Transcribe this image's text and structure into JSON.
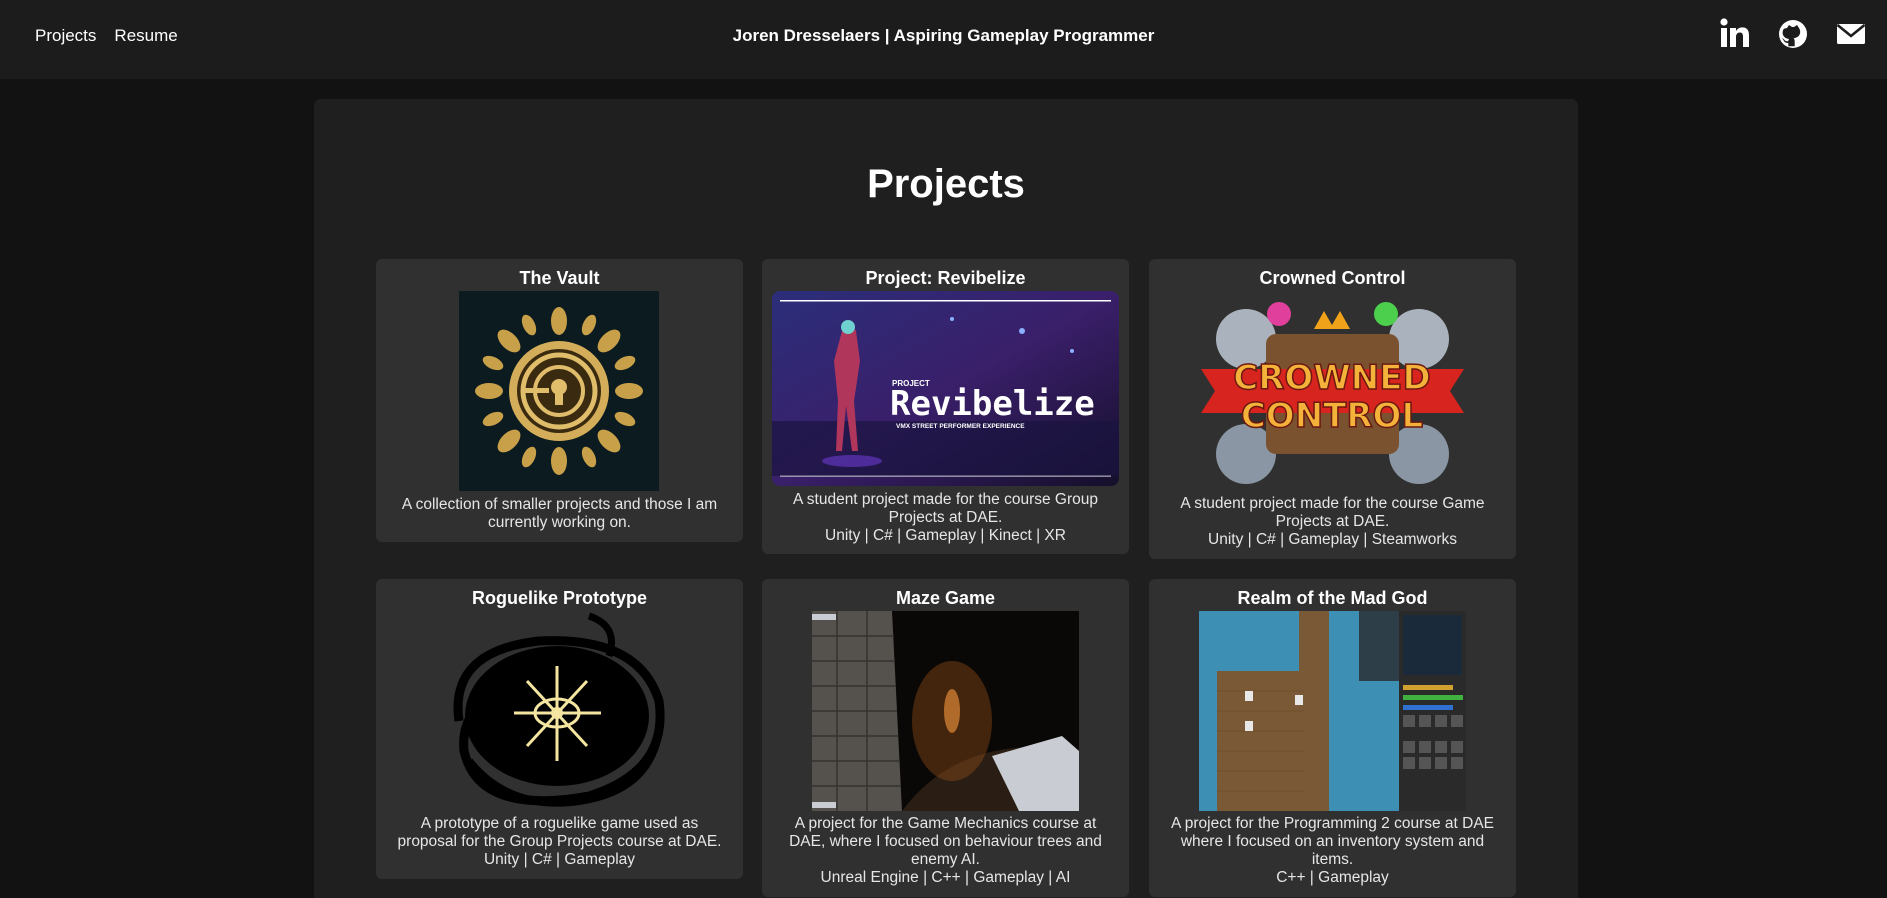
{
  "nav": {
    "links": [
      {
        "label": "Projects"
      },
      {
        "label": "Resume"
      }
    ],
    "title": "Joren Dresselaers | Aspiring Gameplay Programmer",
    "social_icons": [
      "linkedin-icon",
      "github-icon",
      "mail-icon"
    ]
  },
  "main": {
    "heading": "Projects",
    "cards": [
      {
        "title": "The Vault",
        "description": "A collection of smaller projects and those I am currently working on.",
        "tags": ""
      },
      {
        "title": "Project: Revibelize",
        "image_caption": "Revibelize",
        "image_subcaption": "PROJECT",
        "image_tagline": "VMX STREET PERFORMER EXPERIENCE",
        "description": "A student project made for the course Group Projects at DAE.",
        "tags": "Unity | C# | Gameplay | Kinect | XR"
      },
      {
        "title": "Crowned Control",
        "image_caption_line1": "CROWNED",
        "image_caption_line2": "CONTROL",
        "description": "A student project made for the course Game Projects at DAE.",
        "tags": "Unity | C# | Gameplay | Steamworks"
      },
      {
        "title": "Roguelike Prototype",
        "description": "A prototype of a roguelike game used as proposal for the Group Projects course at DAE.",
        "tags": "Unity | C# | Gameplay"
      },
      {
        "title": "Maze Game",
        "description": "A project for the Game Mechanics course at DAE, where I focused on behaviour trees and enemy AI.",
        "tags": "Unreal Engine | C++ | Gameplay | AI"
      },
      {
        "title": "Realm of the Mad God",
        "description": "A project for the Programming 2 course at DAE where I focused on an inventory system and items.",
        "tags": "C++ | Gameplay"
      }
    ]
  },
  "colors": {
    "page_bg": "#121212",
    "topbar_bg": "#1c1c1c",
    "panel_bg": "#1f1f1f",
    "card_bg": "#303030",
    "text": "#ffffff"
  }
}
